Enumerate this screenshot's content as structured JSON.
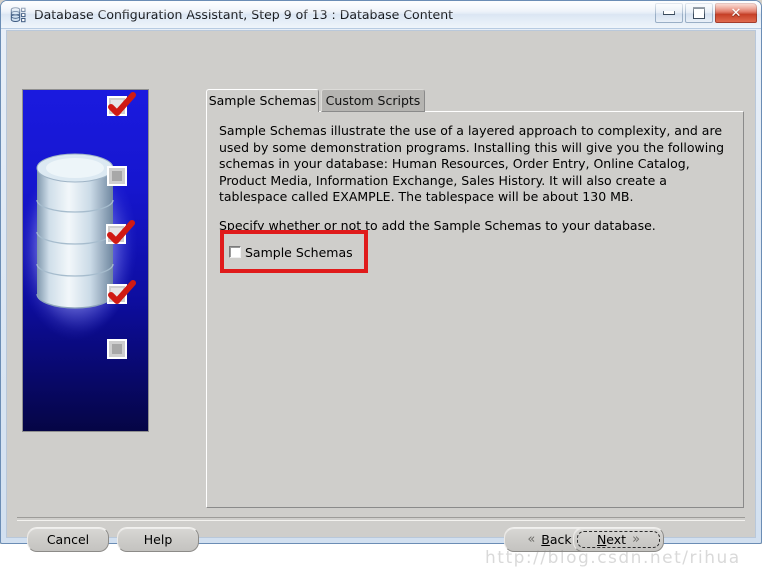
{
  "window": {
    "title": "Database Configuration Assistant, Step 9 of 13 : Database Content",
    "icon": "database-icon",
    "caption_buttons": {
      "minimize_label": "Minimize",
      "maximize_label": "Maximize",
      "close_label": "✕"
    }
  },
  "sidebar": {
    "image_name": "database-progress-graphic",
    "steps": [
      {
        "state": "checked"
      },
      {
        "state": "unchecked"
      },
      {
        "state": "checked"
      },
      {
        "state": "checked"
      },
      {
        "state": "unchecked"
      }
    ]
  },
  "tabs": [
    {
      "label": "Sample Schemas",
      "selected": true
    },
    {
      "label": "Custom Scripts",
      "selected": false
    }
  ],
  "panel": {
    "description": "Sample Schemas illustrate the use of a layered approach to complexity, and are used by some demonstration programs. Installing this will give you the following schemas in your database: Human Resources, Order Entry, Online Catalog, Product Media, Information Exchange, Sales History. It will also create a tablespace called EXAMPLE. The tablespace will be about 130 MB.",
    "instruction": "Specify whether or not to add the Sample Schemas to your database.",
    "checkbox": {
      "label": "Sample Schemas",
      "checked": false
    },
    "highlight_color": "#e01b1b"
  },
  "buttons": {
    "cancel": "Cancel",
    "help": "Help",
    "back": "Back",
    "back_mnemonic": "B",
    "back_rest": "ack",
    "next": "Next",
    "next_mnemonic": "N",
    "next_rest": "ext",
    "back_chevron": "«",
    "next_chevron": "»"
  },
  "watermark": {
    "text": "http://blog.csdn.net/rihua"
  }
}
